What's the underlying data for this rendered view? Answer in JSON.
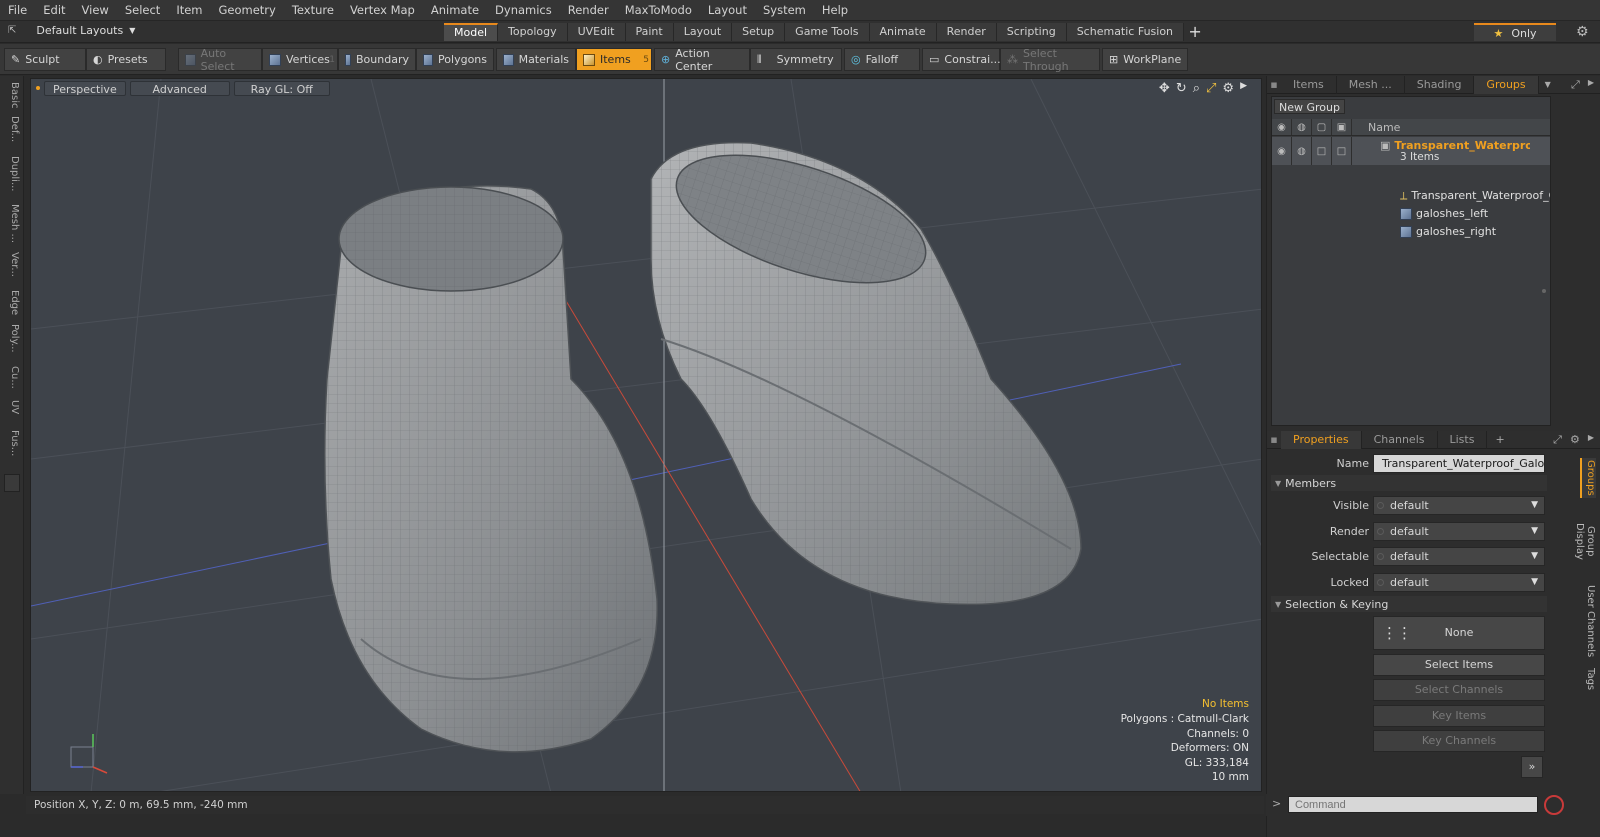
{
  "menu": [
    "File",
    "Edit",
    "View",
    "Select",
    "Item",
    "Geometry",
    "Texture",
    "Vertex Map",
    "Animate",
    "Dynamics",
    "Render",
    "MaxToModo",
    "Layout",
    "System",
    "Help"
  ],
  "layout_selector": "Default Layouts",
  "mode_tabs": [
    {
      "label": "Model",
      "active": true
    },
    {
      "label": "Topology",
      "active": false
    },
    {
      "label": "UVEdit",
      "active": false
    },
    {
      "label": "Paint",
      "active": false
    },
    {
      "label": "Layout",
      "active": false
    },
    {
      "label": "Setup",
      "active": false
    },
    {
      "label": "Game Tools",
      "active": false
    },
    {
      "label": "Animate",
      "active": false
    },
    {
      "label": "Render",
      "active": false
    },
    {
      "label": "Scripting",
      "active": false
    },
    {
      "label": "Schematic Fusion",
      "active": false
    }
  ],
  "only_button": "Only",
  "toolbar": {
    "sculpt": "Sculpt",
    "presets": "Presets",
    "auto_select": "Auto Select",
    "vertices": "Vertices",
    "vertices_num": "1",
    "boundary": "Boundary",
    "polygons": "Polygons",
    "materials": "Materials",
    "items": "Items",
    "items_num": "5",
    "action_center": "Action Center",
    "symmetry": "Symmetry",
    "falloff": "Falloff",
    "constraints": "Constrai...",
    "select_through": "Select Through",
    "workplane": "WorkPlane"
  },
  "left_tabs": [
    "Basic",
    "Def...",
    "Dupli...",
    "Mesh ...",
    "Ver...",
    "Edge",
    "Poly...",
    "Cu...",
    "UV",
    "Fus..."
  ],
  "viewport": {
    "view_mode": "Perspective",
    "advanced": "Advanced",
    "raygl": "Ray GL: Off",
    "stats": {
      "no_items": "No Items",
      "polygons": "Polygons : Catmull-Clark",
      "channels": "Channels: 0",
      "deformers": "Deformers: ON",
      "gl": "GL: 333,184",
      "scale": "10 mm"
    }
  },
  "status": "Position X, Y, Z:   0 m, 69.5 mm, -240 mm",
  "right_top_tabs": [
    {
      "label": "Items",
      "active": false
    },
    {
      "label": "Mesh ...",
      "active": false
    },
    {
      "label": "Shading",
      "active": false
    },
    {
      "label": "Groups",
      "active": true
    }
  ],
  "groups": {
    "new_group": "New Group",
    "name_col": "Name",
    "main": {
      "name": "Transparent_Waterproof ...",
      "count": "3 Items"
    },
    "children": [
      "Transparent_Waterproof_G...",
      "galoshes_left",
      "galoshes_right"
    ]
  },
  "prop_tabs": [
    {
      "label": "Properties",
      "active": true
    },
    {
      "label": "Channels",
      "active": false
    },
    {
      "label": "Lists",
      "active": false
    }
  ],
  "properties": {
    "name_label": "Name",
    "name_value": "Transparent_Waterproof_Galoshes",
    "members": "Members",
    "visible_label": "Visible",
    "visible_value": "default",
    "render_label": "Render",
    "render_value": "default",
    "selectable_label": "Selectable",
    "selectable_value": "default",
    "locked_label": "Locked",
    "locked_value": "default",
    "selection_keying": "Selection & Keying",
    "none": "None",
    "select_items": "Select Items",
    "select_channels": "Select Channels",
    "key_items": "Key Items",
    "key_channels": "Key Channels"
  },
  "side_vtabs": [
    {
      "label": "Groups",
      "active": true
    },
    {
      "label": "Group Display",
      "active": false
    },
    {
      "label": "User Channels",
      "active": false
    },
    {
      "label": "Tags",
      "active": false
    }
  ],
  "command_placeholder": "Command",
  "colors": {
    "accent": "#f0a020",
    "viewport_bg": "#3e434a",
    "panel_bg": "#2d2d2d"
  }
}
